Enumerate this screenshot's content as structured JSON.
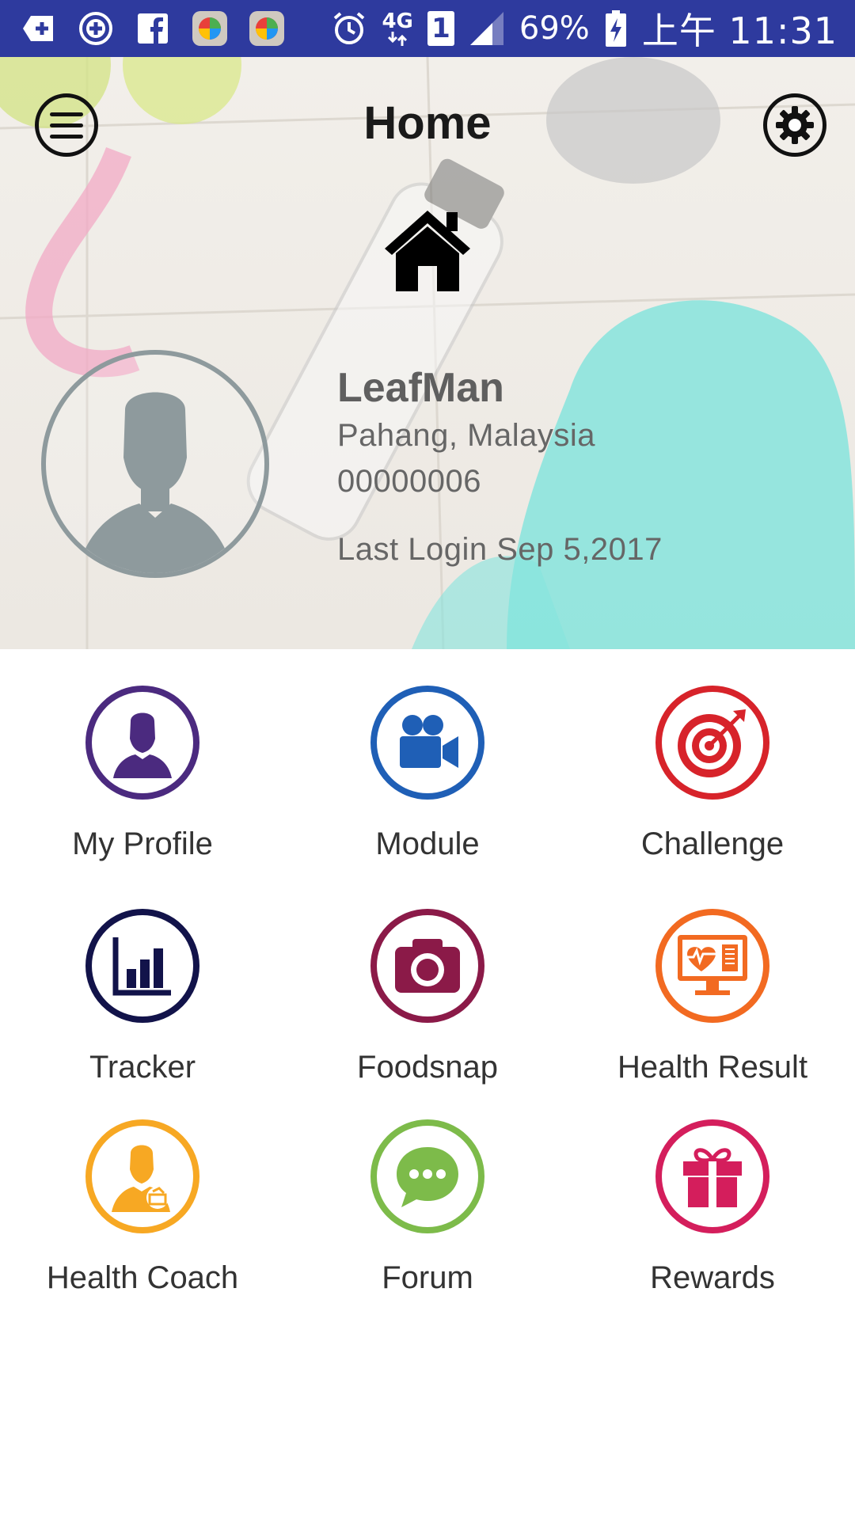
{
  "status_bar": {
    "network": "4G",
    "sim": "1",
    "battery": "69%",
    "time": "上午 11:31"
  },
  "header": {
    "title": "Home",
    "menu_icon": "hamburger-icon",
    "settings_icon": "gear-icon",
    "home_icon": "house-icon"
  },
  "profile": {
    "name": "LeafMan",
    "location": "Pahang, Malaysia",
    "member_id": "00000006",
    "last_login": "Last Login Sep 5,2017"
  },
  "menu": [
    {
      "label": "My Profile",
      "icon": "person-icon",
      "color": "#4b2a7f"
    },
    {
      "label": "Module",
      "icon": "video-camera-icon",
      "color": "#1f5fb6"
    },
    {
      "label": "Challenge",
      "icon": "target-icon",
      "color": "#d7232a"
    },
    {
      "label": "Tracker",
      "icon": "bar-chart-icon",
      "color": "#12134a"
    },
    {
      "label": "Foodsnap",
      "icon": "camera-icon",
      "color": "#8b1a48"
    },
    {
      "label": "Health Result",
      "icon": "heart-monitor-icon",
      "color": "#f26a21"
    },
    {
      "label": "Health Coach",
      "icon": "coach-icon",
      "color": "#f7a823"
    },
    {
      "label": "Forum",
      "icon": "chat-bubble-icon",
      "color": "#7dbb4a"
    },
    {
      "label": "Rewards",
      "icon": "gift-icon",
      "color": "#d41e5c"
    }
  ]
}
